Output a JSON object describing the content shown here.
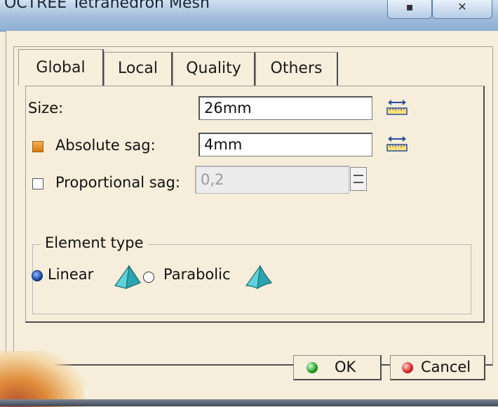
{
  "window": {
    "title": "OCTREE Tetrahedron Mesh",
    "controls": [
      "minimize",
      "close"
    ]
  },
  "tabs": [
    {
      "label": "Global",
      "active": true
    },
    {
      "label": "Local",
      "active": false
    },
    {
      "label": "Quality",
      "active": false
    },
    {
      "label": "Others",
      "active": false
    }
  ],
  "global": {
    "size_label": "Size:",
    "size_value": "26mm",
    "absolute_sag_label": "Absolute sag:",
    "absolute_sag_value": "4mm",
    "absolute_sag_checked": true,
    "proportional_sag_label": "Proportional sag:",
    "proportional_sag_value": "0,2",
    "proportional_sag_checked": false
  },
  "element_type": {
    "title": "Element type",
    "options": [
      {
        "label": "Linear",
        "selected": true
      },
      {
        "label": "Parabolic",
        "selected": false
      }
    ]
  },
  "buttons": {
    "ok": "OK",
    "cancel": "Cancel"
  },
  "colors": {
    "dialog_bg": "#f6eedb",
    "accent_orange": "#e0861a",
    "radio_blue": "#123a9a",
    "ok_green": "#1a9a1a",
    "cancel_red": "#d42020"
  }
}
